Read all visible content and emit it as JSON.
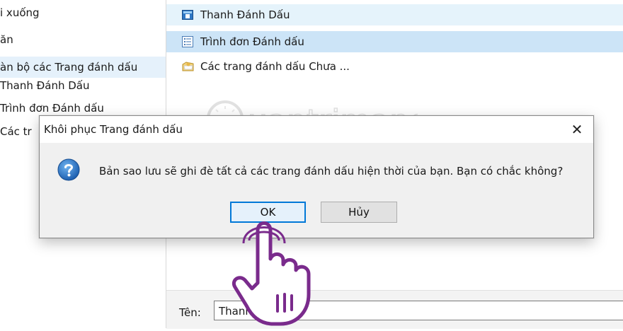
{
  "left_tree": {
    "items": [
      {
        "label": "i xuống"
      },
      {
        "label": "ăn"
      },
      {
        "label": "àn bộ các Trang đánh dấu"
      },
      {
        "label": "Thanh Đánh Dấu"
      },
      {
        "label": "Trình đơn Đánh dấu"
      },
      {
        "label": "Các tr"
      }
    ]
  },
  "list": {
    "rows": [
      {
        "label": "Thanh Đánh Dấu",
        "icon": "bookmarks-toolbar-icon"
      },
      {
        "label": "Trình đơn Đánh dấu",
        "icon": "bookmarks-menu-icon"
      },
      {
        "label": "Các trang đánh dấu Chưa ...",
        "icon": "unsorted-bookmarks-folder-icon"
      }
    ]
  },
  "watermark": {
    "text": "uantrimang"
  },
  "bottom": {
    "name_label": "Tên:",
    "name_value": "Thanh Đ      Dấu"
  },
  "dialog": {
    "title": "Khôi phục Trang đánh dấu",
    "close_glyph": "✕",
    "message": "Bản sao lưu sẽ ghi đè tất cả các trang đánh dấu hiện thời của bạn. Bạn có chắc không?",
    "ok_label": "OK",
    "cancel_label": "Hủy",
    "icon": "question-icon"
  },
  "colors": {
    "selected_row": "#cce4f7",
    "accent_blue": "#0078d7",
    "hand_outline": "#7a2b8c"
  }
}
